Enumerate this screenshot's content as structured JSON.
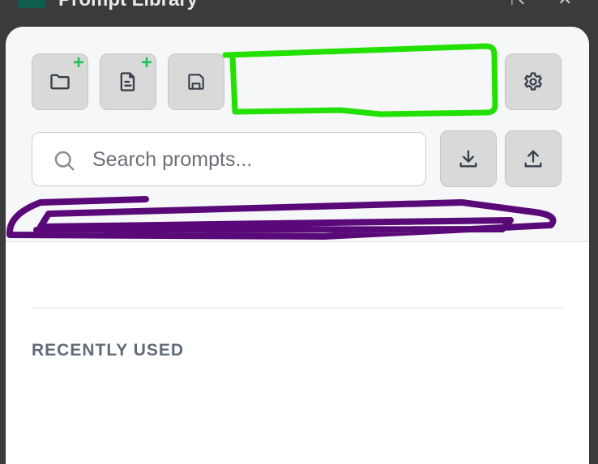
{
  "window": {
    "title": "Prompt Library"
  },
  "toolbar": {
    "new_folder": "+",
    "new_prompt": "+"
  },
  "search": {
    "placeholder": "Search prompts...",
    "value": ""
  },
  "sections": {
    "recently_used": "RECENTLY USED"
  },
  "colors": {
    "accent_plus": "#27c256",
    "annotation_green": "#22e000",
    "annotation_purple": "#5a0a78"
  }
}
